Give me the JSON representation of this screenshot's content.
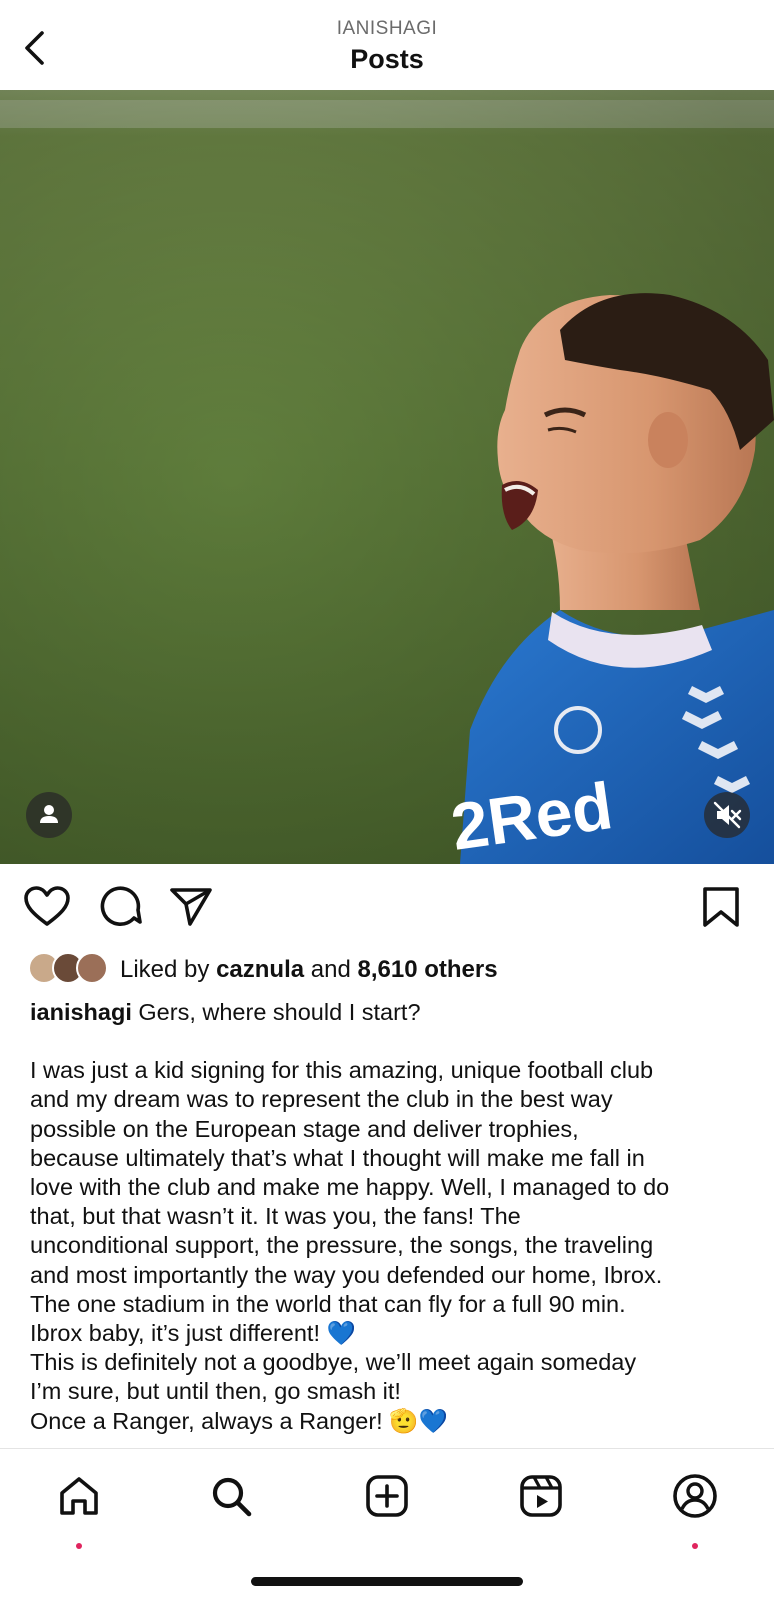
{
  "header": {
    "username": "IANISHAGI",
    "title": "Posts"
  },
  "post": {
    "media_icons": [
      "user-tag-icon",
      "muted-speaker-icon"
    ],
    "jersey_sponsor": "2Red",
    "likes": {
      "prefix": "Liked by ",
      "liker": "caznula",
      "middle": " and ",
      "count": "8,610 others"
    },
    "caption": {
      "author": "ianishagi",
      "first_line": " Gers, where should I start?",
      "lines": [
        "I was just a kid signing for this amazing, unique football club",
        "and my dream was to represent the club in the best way",
        "possible on the European stage and deliver trophies,",
        "because ultimately that’s what I thought will make me fall in",
        "love with the club and make me happy. Well, I managed to do",
        "that, but that wasn’t it. It was you, the fans! The",
        "unconditional support, the pressure, the songs, the traveling",
        "and most importantly the way you defended our home, Ibrox.",
        "The one stadium in the world that can fly for a full 90 min.",
        "Ibrox baby, it’s just different! 💙",
        "This is definitely not a goodbye, we’ll meet again someday",
        "I’m sure, but until then, go smash it!",
        "Once a Ranger, always a Ranger! 🫡💙"
      ]
    }
  },
  "actions": [
    "heart-icon",
    "comment-icon",
    "share-icon",
    "bookmark-icon"
  ],
  "tabbar": [
    "home-icon",
    "search-icon",
    "create-icon",
    "reels-icon",
    "profile-icon"
  ],
  "colors": {
    "pitch": "#5c7a3a",
    "jersey": "#1d63b8",
    "notification_dot": "#e0245e"
  }
}
